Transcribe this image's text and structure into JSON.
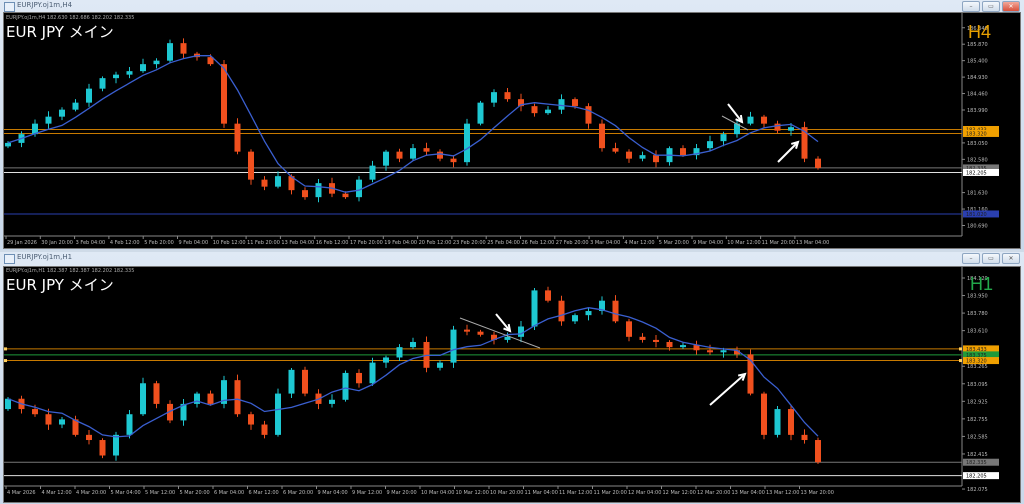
{
  "windows": [
    {
      "title": "EURJPY.oj1m,H4",
      "info": "EURJPY.oj1m,H4  182.630 182.686 182.202 182.335",
      "symbol_label": "EUR JPY  メイン",
      "timeframe_label": "H4",
      "timeframe_color": "#e8a000",
      "buttons": {
        "minimize": "–",
        "restore": "▭",
        "close": "✕"
      }
    },
    {
      "title": "EURJPY.oj1m,H1",
      "info": "EURJPY.oj1m,H1  182.387 182.387 182.202 182.335",
      "symbol_label": "EUR JPY  メイン",
      "timeframe_label": "H1",
      "timeframe_color": "#22a84a",
      "buttons": {
        "minimize": "–",
        "restore": "▭",
        "close": "✕"
      }
    }
  ],
  "colors": {
    "up": "#1ec8d2",
    "down": "#f0501e",
    "ma": "#3a5fd0",
    "background": "#000000"
  },
  "chart_data": [
    {
      "type": "candlestick",
      "timeframe": "H4",
      "grid": false,
      "price_axis_ticks": [
        "186.340",
        "185.870",
        "185.400",
        "184.930",
        "184.460",
        "183.990",
        "183.050",
        "182.580",
        "181.630",
        "181.160",
        "180.690"
      ],
      "time_axis_ticks": [
        "29 Jan 2026",
        "30 Jan 20:00",
        "3 Feb 04:00",
        "4 Feb 12:00",
        "5 Feb 20:00",
        "9 Feb 04:00",
        "10 Feb 12:00",
        "11 Feb 20:00",
        "13 Feb 04:00",
        "16 Feb 12:00",
        "17 Feb 20:00",
        "19 Feb 04:00",
        "20 Feb 12:00",
        "23 Feb 20:00",
        "25 Feb 04:00",
        "26 Feb 12:00",
        "27 Feb 20:00",
        "3 Mar 04:00",
        "4 Mar 12:00",
        "5 Mar 20:00",
        "9 Mar 04:00",
        "10 Mar 12:00",
        "11 Mar 20:00",
        "13 Mar 04:00"
      ],
      "ylim": [
        180.69,
        186.34
      ],
      "closes": [
        183.05,
        183.3,
        183.6,
        183.8,
        184.0,
        184.2,
        184.6,
        184.9,
        185.0,
        185.1,
        185.3,
        185.4,
        185.9,
        185.6,
        185.5,
        185.3,
        183.6,
        182.8,
        182.0,
        181.8,
        182.1,
        181.7,
        181.5,
        181.9,
        181.6,
        181.5,
        182.0,
        182.4,
        182.8,
        182.6,
        182.9,
        182.8,
        182.6,
        182.5,
        183.6,
        184.2,
        184.5,
        184.3,
        184.1,
        183.9,
        184.0,
        184.3,
        184.1,
        183.6,
        182.9,
        182.8,
        182.6,
        182.7,
        182.5,
        182.9,
        182.7,
        182.9,
        183.1,
        183.3,
        183.6,
        183.8,
        183.6,
        183.4,
        183.5,
        182.6,
        182.335
      ],
      "levels": [
        {
          "price": "183.433",
          "color": "#c87a00"
        },
        {
          "price": "183.320",
          "color": "#c87a00"
        },
        {
          "price": "182.335",
          "color": "#777777"
        },
        {
          "price": "182.205",
          "color": "#e0e0e0"
        },
        {
          "price": "181.020",
          "color": "#2a3fb0"
        }
      ]
    },
    {
      "type": "candlestick",
      "timeframe": "H1",
      "grid": false,
      "price_axis_ticks": [
        "184.120",
        "183.950",
        "183.780",
        "183.610",
        "183.265",
        "183.095",
        "182.925",
        "182.755",
        "182.585",
        "182.415",
        "182.075"
      ],
      "time_axis_ticks": [
        "4 Mar 2026",
        "4 Mar 12:00",
        "4 Mar 20:00",
        "5 Mar 04:00",
        "5 Mar 12:00",
        "5 Mar 20:00",
        "6 Mar 04:00",
        "6 Mar 12:00",
        "6 Mar 20:00",
        "9 Mar 04:00",
        "9 Mar 12:00",
        "9 Mar 20:00",
        "10 Mar 04:00",
        "10 Mar 12:00",
        "10 Mar 20:00",
        "11 Mar 04:00",
        "11 Mar 12:00",
        "11 Mar 20:00",
        "12 Mar 04:00",
        "12 Mar 12:00",
        "12 Mar 20:00",
        "13 Mar 04:00",
        "13 Mar 12:00",
        "13 Mar 20:00"
      ],
      "ylim": [
        182.075,
        184.12
      ],
      "closes": [
        182.95,
        182.85,
        182.8,
        182.7,
        182.75,
        182.6,
        182.55,
        182.4,
        182.6,
        182.8,
        183.1,
        182.9,
        182.74,
        182.9,
        183.0,
        182.9,
        183.13,
        182.8,
        182.7,
        182.6,
        183.0,
        183.23,
        183.0,
        182.9,
        182.94,
        183.2,
        183.1,
        183.3,
        183.35,
        183.45,
        183.5,
        183.25,
        183.3,
        183.62,
        183.6,
        183.57,
        183.52,
        183.55,
        183.65,
        184.0,
        183.9,
        183.7,
        183.76,
        183.8,
        183.9,
        183.7,
        183.55,
        183.52,
        183.5,
        183.45,
        183.47,
        183.42,
        183.4,
        183.42,
        183.38,
        183.0,
        182.6,
        182.85,
        182.6,
        182.55,
        182.335
      ],
      "levels": [
        {
          "price": "183.433",
          "color": "#c87a00"
        },
        {
          "price": "183.375",
          "color": "#1f9a3a"
        },
        {
          "price": "183.320",
          "color": "#c87a00"
        },
        {
          "price": "182.335",
          "color": "#777777"
        },
        {
          "price": "182.205",
          "color": "#e0e0e0"
        }
      ]
    }
  ]
}
